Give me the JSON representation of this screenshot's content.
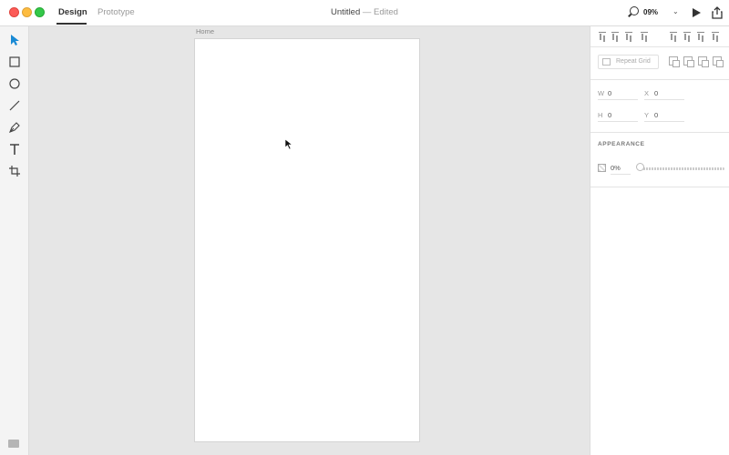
{
  "window": {
    "tabs": [
      {
        "label": "Design",
        "active": true
      },
      {
        "label": "Prototype",
        "active": false
      }
    ],
    "title": "Untitled",
    "title_suffix": "— Edited",
    "zoom": "09%"
  },
  "toolbar": {
    "tools": [
      {
        "name": "select-tool",
        "icon": "arrow-pointer-icon"
      },
      {
        "name": "rectangle-tool",
        "icon": "rectangle-icon"
      },
      {
        "name": "ellipse-tool",
        "icon": "ellipse-icon"
      },
      {
        "name": "line-tool",
        "icon": "line-icon"
      },
      {
        "name": "pen-tool",
        "icon": "pen-icon"
      },
      {
        "name": "text-tool",
        "icon": "text-icon"
      },
      {
        "name": "artboard-tool",
        "icon": "artboard-icon"
      }
    ],
    "accent": "#1a8ad4"
  },
  "canvas": {
    "artboard_label": "Home"
  },
  "panel": {
    "repeat_grid_label": "Repeat Grid",
    "dimensions": {
      "w_label": "W",
      "w_value": "0",
      "x_label": "X",
      "x_value": "0",
      "h_label": "H",
      "h_value": "0",
      "y_label": "Y",
      "y_value": "0"
    },
    "appearance": {
      "title": "APPEARANCE",
      "opacity": "0%"
    }
  }
}
